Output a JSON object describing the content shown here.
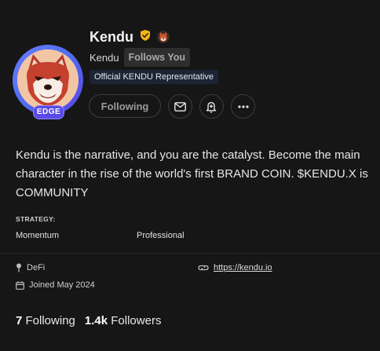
{
  "profile": {
    "name": "Kendu",
    "handle": "Kendu",
    "follows_you": "Follows You",
    "official_tag": "Official KENDU Representative",
    "avatar_badge": "EDGE",
    "verified_icon": "verified-shield-icon",
    "bio": "Kendu is the narrative, and you are the catalyst. Become the main character in the rise of the world's first BRAND COIN. $KENDU.X is COMMUNITY"
  },
  "actions": {
    "following_label": "Following",
    "mail_icon": "mail-icon",
    "notify_icon": "bell-plus-icon",
    "more_icon": "more-horizontal-icon"
  },
  "strategy": {
    "label": "STRATEGY:",
    "values": [
      "Momentum",
      "Professional"
    ]
  },
  "meta": {
    "category": "DeFi",
    "joined": "Joined May 2024",
    "link": "https://kendu.io"
  },
  "counts": {
    "following_count": "7",
    "following_label": "Following",
    "followers_count": "1.4k",
    "followers_label": "Followers"
  },
  "colors": {
    "background": "#161616",
    "avatar_ring": "#5a45e6",
    "verified_gold": "#f2b519",
    "edge_badge": "#5a4be8"
  }
}
